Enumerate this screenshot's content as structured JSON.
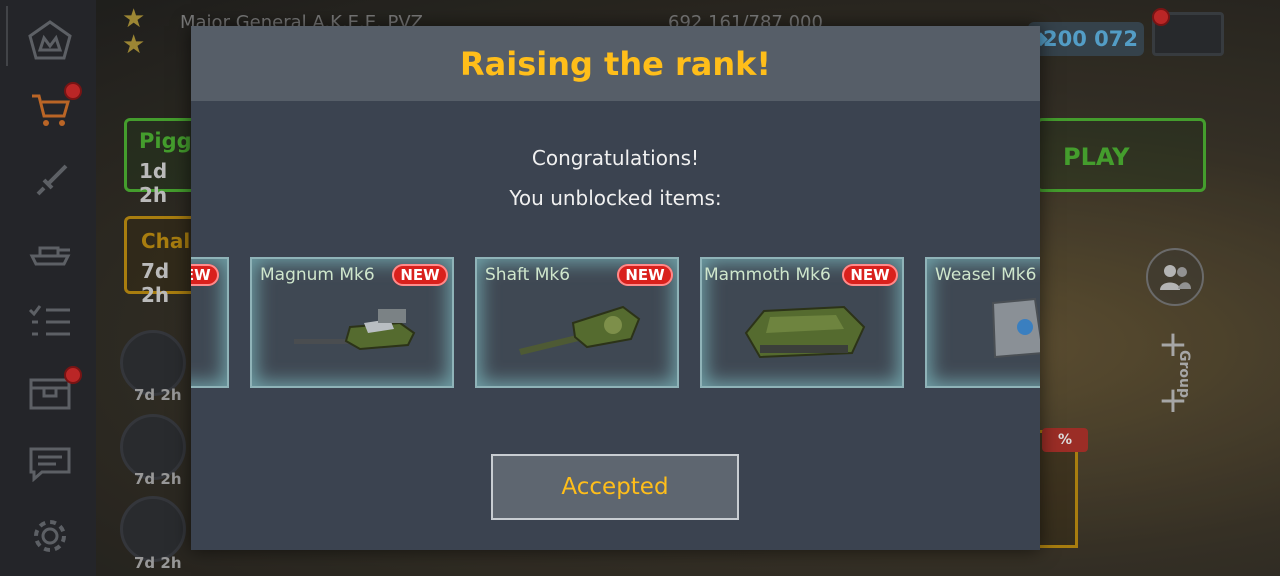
{
  "topbar": {
    "player_name": "Major General A.K.E.E. PVZ",
    "xp": "692 161/787 000",
    "crystals": "200 072",
    "icons": [
      "star-icon",
      "crystal-icon",
      "garage-icon"
    ]
  },
  "sidebar": {
    "items": [
      {
        "name": "home-icon",
        "glyph": "♔"
      },
      {
        "name": "shop-cart-icon",
        "glyph": "🛒"
      },
      {
        "name": "sword-icon",
        "glyph": "🗡"
      },
      {
        "name": "garage-tank-icon",
        "glyph": "⛟"
      },
      {
        "name": "missions-list-icon",
        "glyph": "☰"
      },
      {
        "name": "containers-icon",
        "glyph": "▣"
      },
      {
        "name": "chat-icon",
        "glyph": "💬"
      },
      {
        "name": "settings-gear-icon",
        "glyph": "⚙"
      }
    ]
  },
  "background": {
    "piggy_title": "Piggy",
    "piggy_timer": "1d 2h",
    "challenge_title": "Chal",
    "challenge_timer": "7d 2h",
    "play_label": "PLAY",
    "offer_timers": [
      "7d 2h",
      "7d 2h",
      "7d 2h"
    ],
    "percent_badge": "%",
    "group_label": "Group"
  },
  "modal": {
    "title": "Raising the rank!",
    "congrats": "Congratulations!",
    "subtitle": "You unblocked items:",
    "items": [
      {
        "name": "",
        "badge": "NEW"
      },
      {
        "name": "Magnum Mk6",
        "badge": "NEW"
      },
      {
        "name": "Shaft Mk6",
        "badge": "NEW"
      },
      {
        "name": "Mammoth Mk6",
        "badge": "NEW"
      },
      {
        "name": "Weasel Mk6",
        "badge": ""
      }
    ],
    "accept_label": "Accepted"
  },
  "colors": {
    "title_yellow": "#ffbe1a",
    "badge_red": "#d9201c",
    "card_glow": "#8fb3b8",
    "modal_bg": "#3b4350",
    "header_bg": "#565e68"
  }
}
